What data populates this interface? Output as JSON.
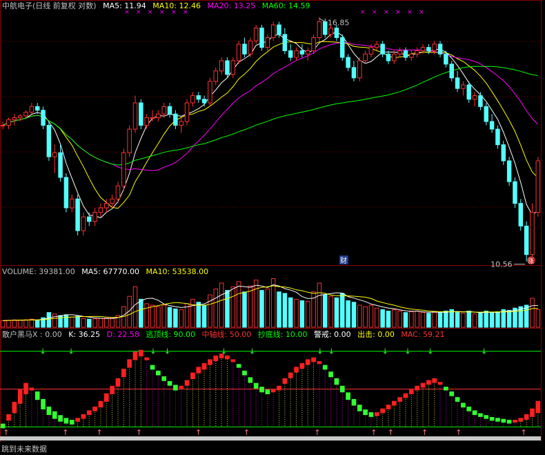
{
  "header": {
    "stock_name": "中航电子(日线 前复权 对数)",
    "ma5": "MA5: 11.94",
    "ma10": "MA10: 12.46",
    "ma20": "MA20: 13.25",
    "ma60": "MA60: 14.59"
  },
  "volume_header": {
    "volume": "VOLUME: 39381.00",
    "ma5": "MA5: 67770.00",
    "ma10": "MA10: 53538.00"
  },
  "indicator_header": {
    "name": "散户黑马X : 0.00",
    "k": "K: 36.25",
    "d": "D: 22.58",
    "top_line": "逃顶线: 90.00",
    "mid_line": "中轴线: 50.00",
    "bottom_line": "抄底线: 10.00",
    "warn": "警戒: 0.00",
    "attack": "出击: 0.00",
    "mac": "MAC: 59.21"
  },
  "annotations": {
    "high_label": "16.85",
    "low_label": "10.56",
    "fin_badge": "财",
    "rise_badge": "涨"
  },
  "bottom": {
    "future_link": "跳到未来数据"
  },
  "colors": {
    "up": "#ff3232",
    "down": "#54ffff",
    "ma5": "#ffffff",
    "ma10": "#ffff00",
    "ma20": "#ff00ff",
    "ma60": "#00ff00",
    "grid": "#8b0000"
  },
  "chart_data": [
    {
      "type": "candlestick",
      "title": "中航电子(日线 前复权 对数)",
      "scale": "log",
      "y_range": [
        10.5,
        17.0
      ],
      "high": 16.85,
      "low": 10.56,
      "ohlc": [
        [
          13.7,
          13.8,
          13.6,
          13.7
        ],
        [
          13.7,
          13.9,
          13.6,
          13.85
        ],
        [
          13.85,
          14.0,
          13.7,
          13.9
        ],
        [
          13.9,
          14.0,
          13.8,
          13.95
        ],
        [
          13.95,
          14.1,
          13.9,
          14.05
        ],
        [
          14.05,
          14.3,
          14.0,
          14.2
        ],
        [
          14.2,
          14.3,
          14.0,
          14.1
        ],
        [
          14.1,
          14.2,
          13.6,
          13.7
        ],
        [
          13.7,
          13.8,
          12.8,
          12.9
        ],
        [
          12.9,
          13.2,
          12.5,
          13.0
        ],
        [
          13.0,
          13.2,
          12.3,
          12.4
        ],
        [
          12.4,
          12.5,
          11.6,
          11.7
        ],
        [
          11.7,
          12.0,
          11.6,
          11.9
        ],
        [
          11.9,
          12.0,
          11.1,
          11.2
        ],
        [
          11.2,
          11.6,
          11.1,
          11.5
        ],
        [
          11.5,
          11.6,
          11.3,
          11.4
        ],
        [
          11.4,
          11.7,
          11.3,
          11.6
        ],
        [
          11.6,
          11.8,
          11.5,
          11.7
        ],
        [
          11.7,
          11.9,
          11.6,
          11.8
        ],
        [
          11.8,
          12.0,
          11.7,
          11.9
        ],
        [
          11.9,
          12.3,
          11.8,
          12.2
        ],
        [
          12.2,
          13.1,
          12.1,
          13.0
        ],
        [
          13.0,
          13.7,
          12.9,
          13.6
        ],
        [
          13.6,
          14.5,
          13.5,
          14.3
        ],
        [
          14.3,
          14.4,
          13.6,
          13.7
        ],
        [
          13.7,
          14.0,
          13.6,
          13.9
        ],
        [
          13.9,
          14.1,
          13.8,
          13.9
        ],
        [
          13.9,
          14.1,
          13.8,
          14.0
        ],
        [
          14.0,
          14.3,
          13.9,
          14.2
        ],
        [
          14.2,
          14.3,
          13.9,
          14.0
        ],
        [
          14.0,
          14.1,
          13.6,
          13.7
        ],
        [
          13.7,
          13.9,
          13.5,
          13.8
        ],
        [
          13.8,
          14.4,
          13.7,
          14.3
        ],
        [
          14.3,
          14.6,
          14.2,
          14.5
        ],
        [
          14.5,
          14.6,
          14.3,
          14.4
        ],
        [
          14.4,
          14.5,
          14.2,
          14.3
        ],
        [
          14.3,
          15.0,
          14.2,
          14.9
        ],
        [
          14.9,
          15.3,
          14.8,
          15.2
        ],
        [
          15.2,
          15.6,
          15.1,
          15.5
        ],
        [
          15.5,
          15.6,
          15.0,
          15.1
        ],
        [
          15.1,
          15.6,
          15.0,
          15.5
        ],
        [
          15.5,
          16.1,
          15.4,
          16.0
        ],
        [
          16.0,
          16.2,
          15.6,
          15.7
        ],
        [
          15.7,
          16.2,
          15.6,
          16.1
        ],
        [
          16.1,
          16.6,
          16.0,
          16.5
        ],
        [
          16.5,
          16.6,
          15.8,
          15.9
        ],
        [
          15.9,
          16.3,
          15.8,
          16.2
        ],
        [
          16.2,
          16.7,
          16.1,
          16.6
        ],
        [
          16.6,
          16.7,
          16.2,
          16.3
        ],
        [
          16.3,
          16.5,
          15.7,
          15.8
        ],
        [
          15.8,
          16.0,
          15.5,
          15.6
        ],
        [
          15.6,
          15.9,
          15.5,
          15.8
        ],
        [
          15.8,
          16.0,
          15.6,
          15.7
        ],
        [
          15.7,
          15.9,
          15.5,
          15.8
        ],
        [
          15.8,
          16.3,
          15.7,
          16.2
        ],
        [
          16.2,
          16.85,
          16.1,
          16.7
        ],
        [
          16.7,
          16.8,
          16.2,
          16.3
        ],
        [
          16.3,
          16.6,
          16.2,
          16.5
        ],
        [
          16.5,
          16.6,
          16.1,
          16.2
        ],
        [
          16.2,
          16.3,
          15.5,
          15.6
        ],
        [
          15.6,
          15.7,
          15.2,
          15.3
        ],
        [
          15.3,
          15.5,
          14.9,
          15.0
        ],
        [
          15.0,
          15.6,
          14.9,
          15.5
        ],
        [
          15.5,
          15.8,
          15.4,
          15.7
        ],
        [
          15.7,
          16.0,
          15.6,
          15.9
        ],
        [
          15.9,
          16.1,
          15.8,
          16.0
        ],
        [
          16.0,
          16.1,
          15.6,
          15.7
        ],
        [
          15.7,
          15.8,
          15.4,
          15.5
        ],
        [
          15.5,
          15.8,
          15.4,
          15.7
        ],
        [
          15.7,
          15.9,
          15.6,
          15.8
        ],
        [
          15.8,
          15.9,
          15.5,
          15.6
        ],
        [
          15.6,
          15.8,
          15.5,
          15.7
        ],
        [
          15.7,
          15.9,
          15.6,
          15.8
        ],
        [
          15.8,
          16.0,
          15.7,
          15.9
        ],
        [
          15.9,
          16.0,
          15.7,
          15.8
        ],
        [
          15.8,
          16.1,
          15.7,
          16.0
        ],
        [
          16.0,
          16.1,
          15.6,
          15.7
        ],
        [
          15.7,
          15.8,
          15.3,
          15.4
        ],
        [
          15.4,
          15.5,
          14.9,
          15.0
        ],
        [
          15.0,
          15.2,
          14.6,
          14.7
        ],
        [
          14.7,
          14.9,
          14.5,
          14.8
        ],
        [
          14.8,
          14.9,
          14.3,
          14.4
        ],
        [
          14.4,
          14.6,
          14.2,
          14.5
        ],
        [
          14.5,
          14.6,
          14.1,
          14.2
        ],
        [
          14.2,
          14.3,
          13.7,
          13.8
        ],
        [
          13.8,
          14.0,
          13.5,
          13.6
        ],
        [
          13.6,
          13.7,
          13.1,
          13.2
        ],
        [
          13.2,
          13.3,
          12.7,
          12.8
        ],
        [
          12.8,
          12.9,
          12.2,
          12.3
        ],
        [
          12.3,
          12.4,
          11.7,
          11.8
        ],
        [
          11.8,
          11.9,
          11.2,
          11.3
        ],
        [
          11.3,
          11.4,
          10.56,
          10.7
        ],
        [
          10.7,
          11.8,
          10.6,
          11.6
        ],
        [
          11.6,
          12.9,
          11.5,
          12.8
        ]
      ],
      "ma_periods": [
        5,
        10,
        20,
        60
      ]
    },
    {
      "type": "bar",
      "title": "VOLUME",
      "values": [
        9000,
        9500,
        10000,
        9800,
        10200,
        11000,
        9500,
        13000,
        20000,
        18000,
        16000,
        17000,
        14000,
        15000,
        12000,
        11000,
        11500,
        12000,
        12500,
        13000,
        16000,
        28000,
        42000,
        55000,
        38000,
        32000,
        30000,
        28000,
        30000,
        27000,
        25000,
        24000,
        32000,
        38000,
        34000,
        30000,
        44000,
        52000,
        60000,
        50000,
        55000,
        62000,
        48000,
        56000,
        64000,
        50000,
        52000,
        66000,
        48000,
        46000,
        40000,
        38000,
        36000,
        35000,
        48000,
        60000,
        44000,
        42000,
        40000,
        46000,
        36000,
        34000,
        30000,
        28000,
        30000,
        26000,
        24000,
        22000,
        24000,
        22000,
        20000,
        21000,
        22000,
        20000,
        19000,
        21000,
        20000,
        22000,
        24000,
        20000,
        19000,
        22000,
        18000,
        20000,
        22000,
        20000,
        21000,
        24000,
        23000,
        26000,
        28000,
        30000,
        39381,
        24000
      ]
    },
    {
      "type": "line",
      "title": "散户黑马X",
      "series": [
        {
          "name": "K",
          "values": [
            10,
            22,
            35,
            48,
            55,
            50,
            40,
            30,
            24,
            20,
            17,
            15,
            14,
            18,
            22,
            26,
            30,
            36,
            44,
            52,
            60,
            70,
            80,
            88,
            90,
            82,
            72,
            66,
            60,
            55,
            50,
            52,
            58,
            66,
            72,
            76,
            80,
            84,
            86,
            84,
            80,
            74,
            66,
            58,
            52,
            48,
            46,
            48,
            52,
            60,
            66,
            72,
            76,
            80,
            82,
            78,
            72,
            64,
            56,
            48,
            40,
            34,
            28,
            24,
            22,
            24,
            28,
            32,
            36,
            40,
            44,
            48,
            52,
            55,
            58,
            60,
            56,
            50,
            44,
            38,
            32,
            28,
            24,
            22,
            20,
            18,
            17,
            16,
            15,
            16,
            18,
            22,
            28,
            36
          ]
        },
        {
          "name": "D",
          "values": [
            12,
            18,
            26,
            36,
            46,
            50,
            46,
            38,
            30,
            25,
            21,
            18,
            16,
            17,
            20,
            24,
            28,
            32,
            38,
            46,
            54,
            64,
            74,
            82,
            86,
            82,
            74,
            68,
            62,
            57,
            53,
            52,
            55,
            62,
            68,
            72,
            77,
            81,
            84,
            83,
            80,
            75,
            68,
            61,
            55,
            51,
            48,
            48,
            50,
            57,
            63,
            69,
            73,
            77,
            80,
            78,
            74,
            67,
            60,
            52,
            45,
            38,
            32,
            27,
            24,
            23,
            26,
            30,
            34,
            38,
            42,
            46,
            50,
            53,
            56,
            58,
            56,
            51,
            46,
            40,
            34,
            30,
            26,
            23,
            21,
            19,
            18,
            17,
            16,
            16,
            17,
            19,
            22,
            26
          ]
        }
      ],
      "levels": {
        "top": 90,
        "mid": 50,
        "bottom": 10
      },
      "y_range": [
        0,
        100
      ]
    }
  ]
}
